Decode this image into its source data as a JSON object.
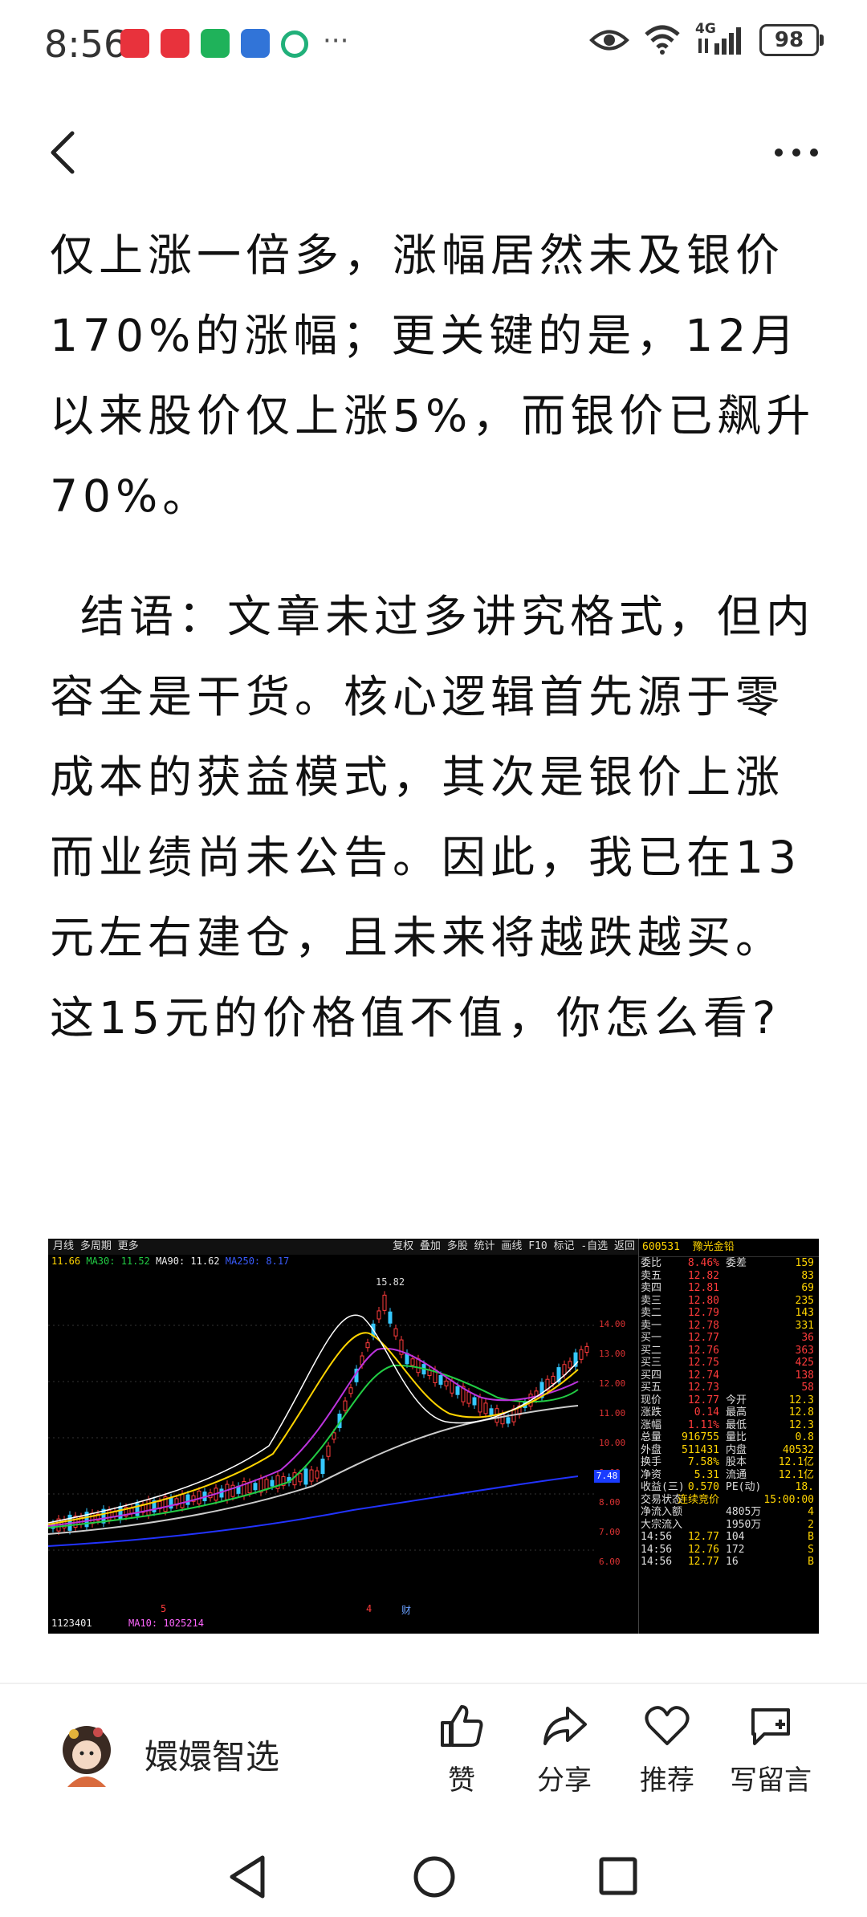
{
  "status_bar": {
    "time": "8:56",
    "network": "4G",
    "battery": "98",
    "more_indicator": "···"
  },
  "nav": {
    "back_icon": "chevron-left-icon",
    "more_icon": "more-dots-icon"
  },
  "article": {
    "paragraph1": "仅上涨一倍多，涨幅居然未及银价170%的涨幅；更关键的是，12月以来股价仅上涨5%，而银价已飙升70%。",
    "paragraph2": "结语：文章未过多讲究格式，但内容全是干货。核心逻辑首先源于零成本的获益模式，其次是银价上涨而业绩尚未公告。因此，我已在13元左右建仓，且未来将越跌越买。这15元的价格值不值，你怎么看?"
  },
  "chart": {
    "toolbar_left": "月线  多周期  更多",
    "toolbar_right": "复权 叠加 多股 统计 画线 F10 标记 -自选 返回",
    "ma_legend": {
      "ma10": "11.66",
      "ma30_label": "MA30: 11.52",
      "ma90_label": "MA90: 11.62",
      "ma250_label": "MA250: 8.17"
    },
    "peak_label": "15.82",
    "y_ticks": [
      "14.00",
      "13.00",
      "12.00",
      "11.00",
      "10.00",
      "9.00",
      "8.00",
      "7.00",
      "6.00"
    ],
    "current_tag": "7.48",
    "volume_label": "1123401",
    "volume_ma_label": "MA10: 1025214",
    "marker1": "5",
    "marker2": "4",
    "marker3": "财",
    "stock_code": "600531",
    "stock_name": "豫光金铅",
    "quote_rows": [
      {
        "l": "委比",
        "v": "8.46%",
        "l2": "委差",
        "v2": "159"
      },
      {
        "l": "卖五",
        "v": "12.82",
        "l2": "",
        "v2": "83"
      },
      {
        "l": "卖四",
        "v": "12.81",
        "l2": "",
        "v2": "69"
      },
      {
        "l": "卖三",
        "v": "12.80",
        "l2": "",
        "v2": "235"
      },
      {
        "l": "卖二",
        "v": "12.79",
        "l2": "",
        "v2": "143"
      },
      {
        "l": "卖一",
        "v": "12.78",
        "l2": "",
        "v2": "331"
      },
      {
        "l": "买一",
        "v": "12.77",
        "l2": "",
        "v2": "36"
      },
      {
        "l": "买二",
        "v": "12.76",
        "l2": "",
        "v2": "363"
      },
      {
        "l": "买三",
        "v": "12.75",
        "l2": "",
        "v2": "425"
      },
      {
        "l": "买四",
        "v": "12.74",
        "l2": "",
        "v2": "138"
      },
      {
        "l": "买五",
        "v": "12.73",
        "l2": "",
        "v2": "58"
      },
      {
        "l": "现价",
        "v": "12.77",
        "l2": "今开",
        "v2": "12.3"
      },
      {
        "l": "涨跌",
        "v": "0.14",
        "l2": "最高",
        "v2": "12.8"
      },
      {
        "l": "涨幅",
        "v": "1.11%",
        "l2": "最低",
        "v2": "12.3"
      },
      {
        "l": "总量",
        "v": "916755",
        "l2": "量比",
        "v2": "0.8"
      },
      {
        "l": "外盘",
        "v": "511431",
        "l2": "内盘",
        "v2": "40532"
      },
      {
        "l": "换手",
        "v": "7.58%",
        "l2": "股本",
        "v2": "12.1亿"
      },
      {
        "l": "净资",
        "v": "5.31",
        "l2": "流通",
        "v2": "12.1亿"
      },
      {
        "l": "收益(三)",
        "v": "0.570",
        "l2": "PE(动)",
        "v2": "18."
      },
      {
        "l": "交易状态",
        "v": "连续竞价",
        "l2": "",
        "v2": "15:00:00"
      },
      {
        "l": "净流入额",
        "v": "",
        "l2": "4805万",
        "v2": "4"
      },
      {
        "l": "大宗流入",
        "v": "",
        "l2": "1950万",
        "v2": "2"
      },
      {
        "l": "14:56",
        "v": "12.77",
        "l2": "104",
        "v2": "B"
      },
      {
        "l": "14:56",
        "v": "12.76",
        "l2": "172",
        "v2": "S"
      },
      {
        "l": "14:56",
        "v": "12.77",
        "l2": "16",
        "v2": "B"
      }
    ]
  },
  "footer": {
    "author": "嬛嬛智选",
    "actions": [
      {
        "label": "赞",
        "icon": "thumbs-up-icon"
      },
      {
        "label": "分享",
        "icon": "share-icon"
      },
      {
        "label": "推荐",
        "icon": "heart-icon"
      },
      {
        "label": "写留言",
        "icon": "comment-add-icon"
      }
    ]
  },
  "system_nav": {
    "back": "triangle-back-icon",
    "home": "circle-home-icon",
    "recents": "square-recents-icon"
  }
}
